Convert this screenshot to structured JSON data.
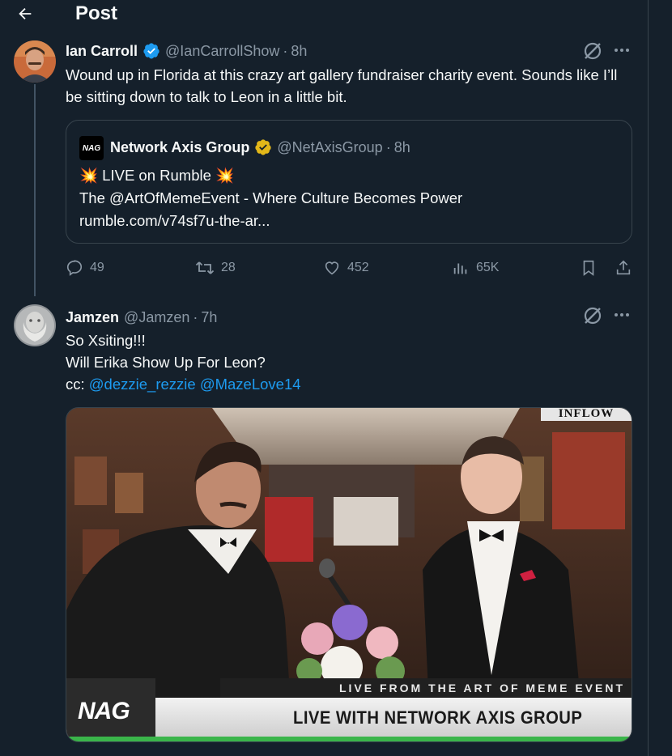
{
  "header": {
    "title": "Post"
  },
  "tweet1": {
    "name": "Ian Carroll",
    "handle": "@IanCarrollShow",
    "dot": "·",
    "time": "8h",
    "text": "Wound up in Florida at this crazy art gallery fundraiser charity event. Sounds like I’ll be sitting down to talk to Leon in a little bit.",
    "quote": {
      "logo_text": "NAG",
      "name": "Network Axis Group",
      "handle": "@NetAxisGroup",
      "dot": "·",
      "time": "8h",
      "line1": "💥 LIVE on Rumble 💥",
      "line2": "The @ArtOfMemeEvent - Where Culture Becomes Power",
      "line3": "rumble.com/v74sf7u-the-ar..."
    },
    "actions": {
      "replies": "49",
      "reposts": "28",
      "likes": "452",
      "views": "65K"
    }
  },
  "tweet2": {
    "name": "Jamzen",
    "handle": "@Jamzen",
    "dot": "·",
    "time": "7h",
    "line1": "So Xsiting!!!",
    "line2": "Will Erika Show Up For Leon?",
    "cc_label": "cc:",
    "mention1": "@dezzie_rezzie",
    "mention2": "@MazeLove14",
    "media": {
      "banner_top": "INFLOW",
      "lower_third_top": "LIVE FROM THE ART OF MEME EVENT",
      "lower_third_main": "LIVE WITH NETWORK AXIS GROUP",
      "logo": "NAG"
    }
  },
  "colors": {
    "background": "#15202b",
    "text": "#f7f9f9",
    "muted": "#8b98a5",
    "link": "#1d9bf0",
    "verified_blue": "#1d9bf0",
    "verified_gold": "#e2b719",
    "border": "#38444d"
  }
}
